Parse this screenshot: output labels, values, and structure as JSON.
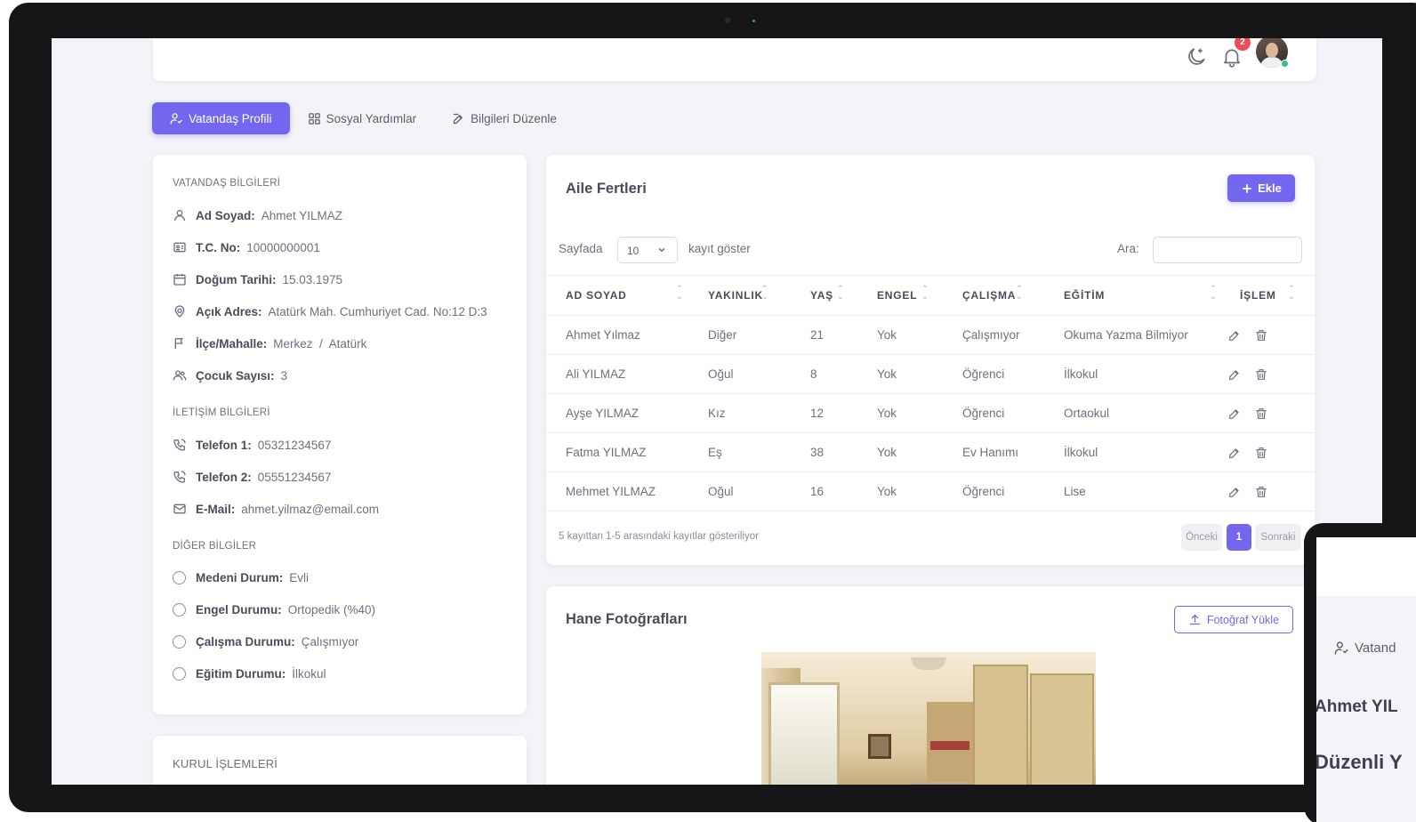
{
  "header": {
    "notification_count": "2"
  },
  "tabs": [
    {
      "label": "Vatandaş Profili",
      "icon": "user-check-icon",
      "active": true
    },
    {
      "label": "Sosyal Yardımlar",
      "icon": "grid-icon",
      "active": false
    },
    {
      "label": "Bilgileri Düzenle",
      "icon": "edit-icon",
      "active": false
    }
  ],
  "citizen": {
    "section_title": "VATANDAŞ BİLGİLERİ",
    "name_label": "Ad Soyad:",
    "name": "Ahmet YILMAZ",
    "tc_label": "T.C. No:",
    "tc": "10000000001",
    "birth_label": "Doğum Tarihi:",
    "birth": "15.03.1975",
    "address_label": "Açık Adres:",
    "address": "Atatürk Mah. Cumhuriyet Cad. No:12 D:3",
    "district_label": "İlçe/Mahalle:",
    "district": "Merkez  /  Atatürk",
    "children_label": "Çocuk Sayısı:",
    "children": "3"
  },
  "contact": {
    "section_title": "İLETİŞİM BİLGİLERİ",
    "phone1_label": "Telefon 1:",
    "phone1": "05321234567",
    "phone2_label": "Telefon 2:",
    "phone2": "05551234567",
    "email_label": "E-Mail:",
    "email": "ahmet.yilmaz@email.com"
  },
  "other": {
    "section_title": "DİĞER BİLGİLER",
    "marital_label": "Medeni Durum:",
    "marital": "Evli",
    "disability_label": "Engel Durumu:",
    "disability": "Ortopedik (%40)",
    "work_label": "Çalışma Durumu:",
    "work": "Çalışmıyor",
    "education_label": "Eğitim Durumu:",
    "education": "İlkokul"
  },
  "kurul": {
    "section_title": "KURUL İŞLEMLERİ"
  },
  "family": {
    "title": "Aile Fertleri",
    "add_button": "Ekle",
    "per_page_label": "Sayfada",
    "per_page_value": "10",
    "per_page_after": "kayıt göster",
    "search_label": "Ara:",
    "search_value": "",
    "columns": [
      "AD SOYAD",
      "YAKINLIK",
      "YAŞ",
      "ENGEL",
      "ÇALIŞMA",
      "EĞİTİM",
      "İŞLEM"
    ],
    "rows": [
      [
        "Ahmet Yılmaz",
        "Diğer",
        "21",
        "Yok",
        "Çalışmıyor",
        "Okuma Yazma Bilmiyor"
      ],
      [
        "Ali YILMAZ",
        "Oğul",
        "8",
        "Yok",
        "Öğrenci",
        "İlkokul"
      ],
      [
        "Ayşe YILMAZ",
        "Kız",
        "12",
        "Yok",
        "Öğrenci",
        "Ortaokul"
      ],
      [
        "Fatma YILMAZ",
        "Eş",
        "38",
        "Yok",
        "Ev Hanımı",
        "İlkokul"
      ],
      [
        "Mehmet YILMAZ",
        "Oğul",
        "16",
        "Yok",
        "Öğrenci",
        "Lise"
      ]
    ],
    "footer_text": "5 kayıttan 1-5 arasındaki kayıtlar gösteriliyor",
    "prev_label": "Önceki",
    "current_page": "1",
    "next_label": "Sonraki"
  },
  "photos": {
    "title": "Hane Fotoğrafları",
    "upload_button": "Fotoğraf Yükle"
  },
  "tablet": {
    "tab_label": "Vatand",
    "name": "Ahmet YIL",
    "heading": "Düzenli Y"
  },
  "colors": {
    "primary": "#7367f0",
    "badge": "#f04c57",
    "online": "#2ec27e",
    "background": "#f3f3f8"
  }
}
